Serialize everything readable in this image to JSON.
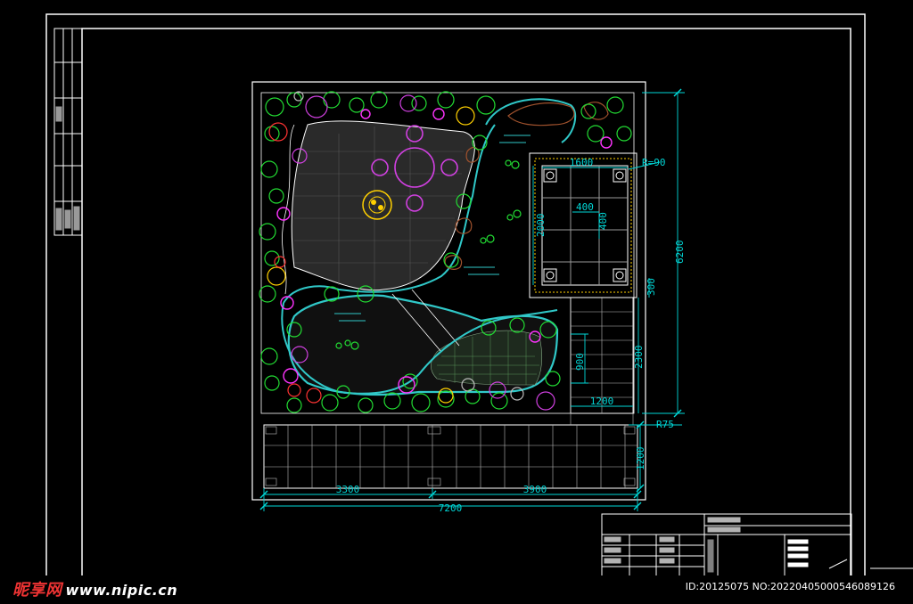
{
  "drawing": {
    "dimensions": {
      "d1600": "1600",
      "r90": "R=90",
      "d400a": "400",
      "d400b": "400",
      "d2000": "2000",
      "d6200": "6200",
      "d300": "300",
      "d2300": "2300",
      "d900": "900",
      "d1200h": "1200",
      "r75": "R75",
      "d1200v": "1200",
      "d3300": "3300",
      "d3900": "3900",
      "d7200": "7200"
    },
    "colors": {
      "frame": "#ffffff",
      "dimension": "#00d8d8",
      "pavilion": "#ffd000",
      "table": "#d040e0",
      "pond": "#30c8c8",
      "plants_green": "#22dd33",
      "plants_magenta": "#ff33ff",
      "plants_red": "#ff3333",
      "rocks": "#a0522d"
    }
  },
  "watermark": {
    "logo": "昵享网",
    "url": "www.nipic.cn",
    "id": "ID:20125075 NO:20220405000546089126"
  }
}
